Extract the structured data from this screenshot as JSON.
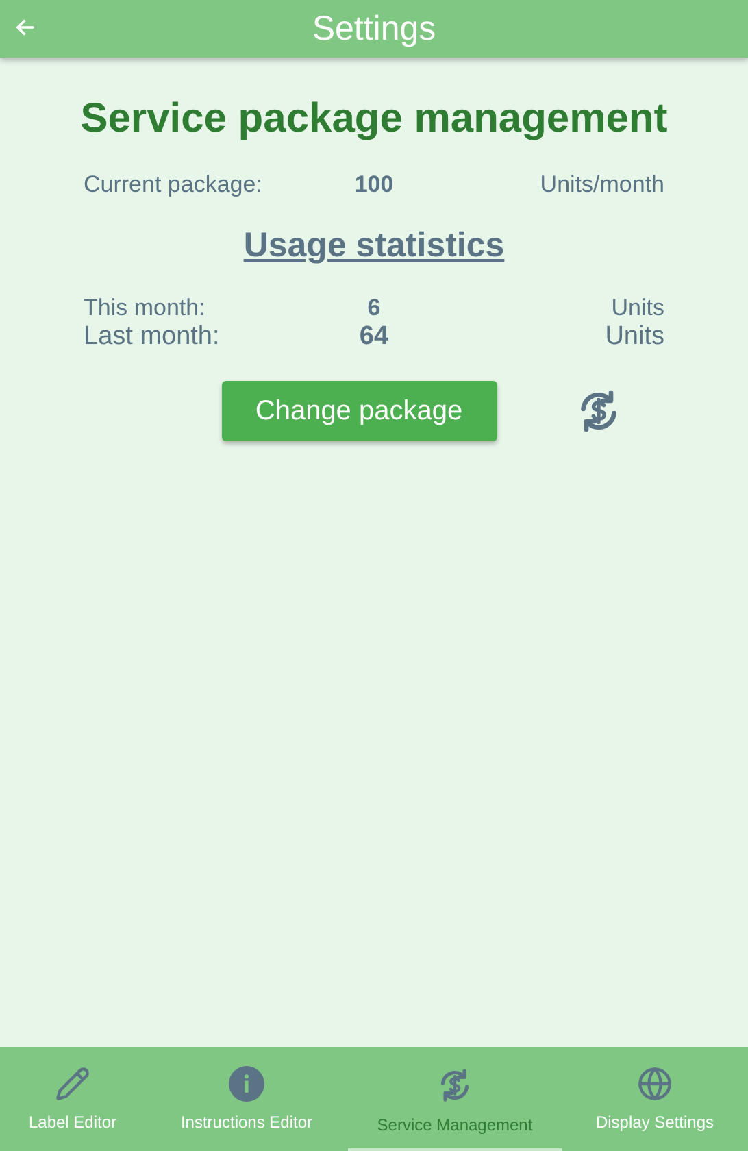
{
  "app_bar": {
    "title": "Settings"
  },
  "heading": "Service package management",
  "current_package": {
    "label": "Current package:",
    "value": "100",
    "unit": "Units/month"
  },
  "usage": {
    "title": "Usage statistics",
    "rows": [
      {
        "label": "This month:",
        "value": "6",
        "unit": "Units"
      },
      {
        "label": "Last month:",
        "value": "64",
        "unit": "Units"
      }
    ]
  },
  "change_button": "Change package",
  "nav": [
    {
      "label": "Label Editor",
      "selected": false
    },
    {
      "label": "Instructions Editor",
      "selected": false
    },
    {
      "label": "Service Management",
      "selected": true
    },
    {
      "label": "Display Settings",
      "selected": false
    }
  ]
}
